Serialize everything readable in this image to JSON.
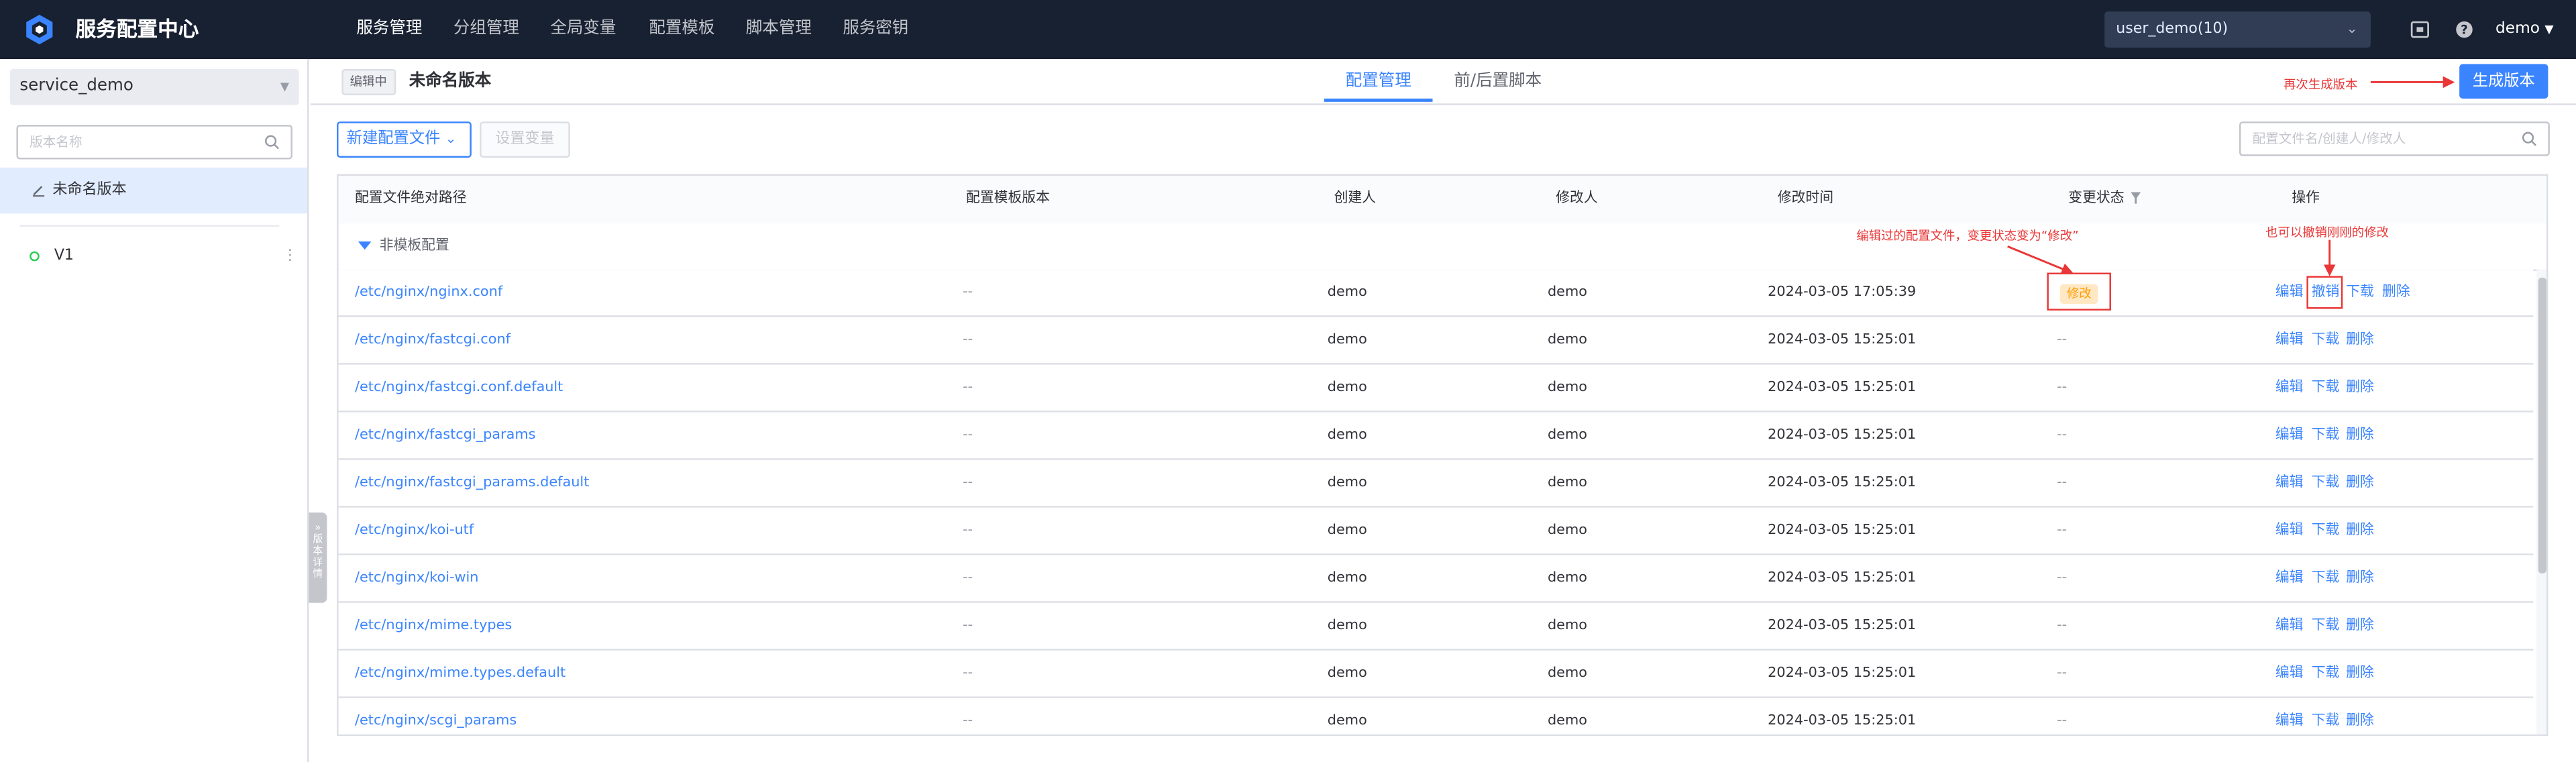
{
  "app": {
    "title": "服务配置中心"
  },
  "nav": {
    "items": [
      "服务管理",
      "分组管理",
      "全局变量",
      "配置模板",
      "脚本管理",
      "服务密钥"
    ],
    "active": "服务管理"
  },
  "topbar": {
    "business": "user_demo(10)",
    "user": "demo",
    "icons": [
      "screen-icon",
      "help-icon"
    ]
  },
  "sidebar": {
    "service": "service_demo",
    "search_placeholder": "版本名称",
    "versions": [
      {
        "label": "未命名版本",
        "icon": "pen-icon",
        "active": true
      },
      {
        "label": "V1",
        "icon": "status-dot-icon",
        "active": false
      }
    ],
    "collapse_label": "»版本详情"
  },
  "header": {
    "status_tag": "编辑中",
    "version_title": "未命名版本",
    "tabs": [
      "配置管理",
      "前/后置脚本"
    ],
    "active_tab": "配置管理",
    "generate_button": "生成版本"
  },
  "toolbar": {
    "new_config_button": "新建配置文件",
    "set_vars_button": "设置变量",
    "search_placeholder": "配置文件名/创建人/修改人"
  },
  "table": {
    "columns": [
      "配置文件绝对路径",
      "配置模板版本",
      "创建人",
      "修改人",
      "修改时间",
      "变更状态",
      "操作"
    ],
    "group_label": "非模板配置",
    "rows": [
      {
        "path": "/etc/nginx/nginx.conf",
        "template": "--",
        "creator": "demo",
        "modifier": "demo",
        "time": "2024-03-05 17:05:39",
        "status": "修改",
        "actions": [
          "编辑",
          "撤销",
          "下载",
          "删除"
        ]
      },
      {
        "path": "/etc/nginx/fastcgi.conf",
        "template": "--",
        "creator": "demo",
        "modifier": "demo",
        "time": "2024-03-05 15:25:01",
        "status": "--",
        "actions": [
          "编辑",
          "下载",
          "删除"
        ]
      },
      {
        "path": "/etc/nginx/fastcgi.conf.default",
        "template": "--",
        "creator": "demo",
        "modifier": "demo",
        "time": "2024-03-05 15:25:01",
        "status": "--",
        "actions": [
          "编辑",
          "下载",
          "删除"
        ]
      },
      {
        "path": "/etc/nginx/fastcgi_params",
        "template": "--",
        "creator": "demo",
        "modifier": "demo",
        "time": "2024-03-05 15:25:01",
        "status": "--",
        "actions": [
          "编辑",
          "下载",
          "删除"
        ]
      },
      {
        "path": "/etc/nginx/fastcgi_params.default",
        "template": "--",
        "creator": "demo",
        "modifier": "demo",
        "time": "2024-03-05 15:25:01",
        "status": "--",
        "actions": [
          "编辑",
          "下载",
          "删除"
        ]
      },
      {
        "path": "/etc/nginx/koi-utf",
        "template": "--",
        "creator": "demo",
        "modifier": "demo",
        "time": "2024-03-05 15:25:01",
        "status": "--",
        "actions": [
          "编辑",
          "下载",
          "删除"
        ]
      },
      {
        "path": "/etc/nginx/koi-win",
        "template": "--",
        "creator": "demo",
        "modifier": "demo",
        "time": "2024-03-05 15:25:01",
        "status": "--",
        "actions": [
          "编辑",
          "下载",
          "删除"
        ]
      },
      {
        "path": "/etc/nginx/mime.types",
        "template": "--",
        "creator": "demo",
        "modifier": "demo",
        "time": "2024-03-05 15:25:01",
        "status": "--",
        "actions": [
          "编辑",
          "下载",
          "删除"
        ]
      },
      {
        "path": "/etc/nginx/mime.types.default",
        "template": "--",
        "creator": "demo",
        "modifier": "demo",
        "time": "2024-03-05 15:25:01",
        "status": "--",
        "actions": [
          "编辑",
          "下载",
          "删除"
        ]
      },
      {
        "path": "/etc/nginx/scgi_params",
        "template": "--",
        "creator": "demo",
        "modifier": "demo",
        "time": "2024-03-05 15:25:01",
        "status": "--",
        "actions": [
          "编辑",
          "下载",
          "删除"
        ]
      }
    ]
  },
  "annotations": {
    "regenerate": "再次生成版本",
    "status_change": "编辑过的配置文件，变更状态变为“修改”",
    "revert": "也可以撤销刚刚的修改",
    "color": "#ea3636"
  },
  "colors": {
    "primary": "#3a84ff",
    "nav_bg": "#182132",
    "warning_bg": "#ffe8c3",
    "warning_text": "#ff9c01"
  }
}
